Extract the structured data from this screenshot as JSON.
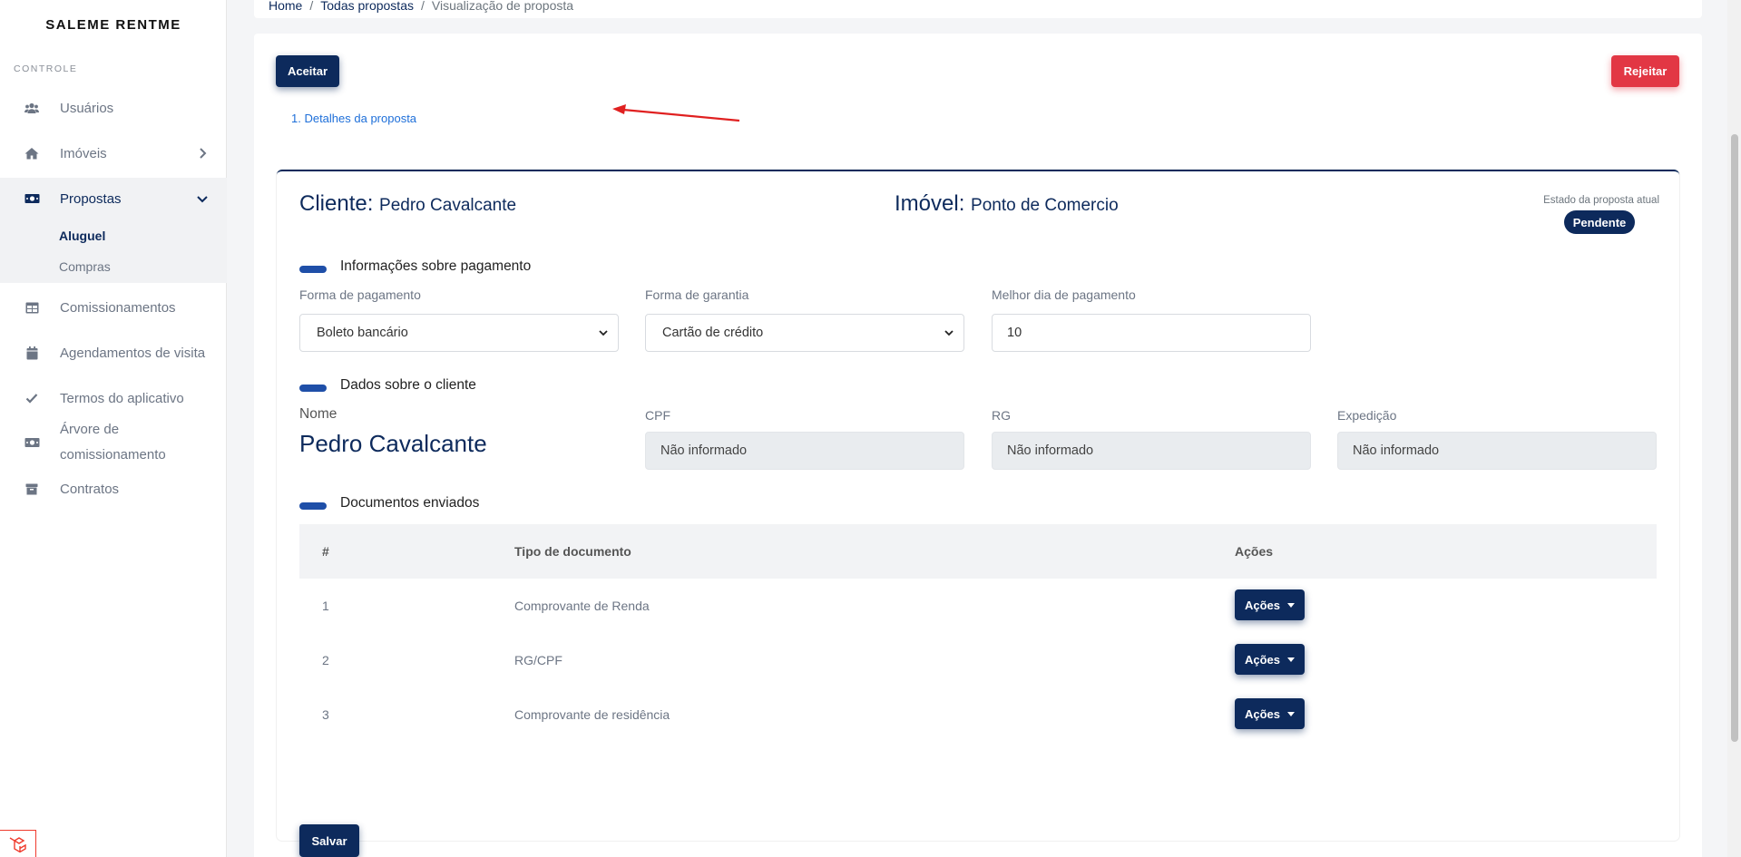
{
  "app": {
    "brand": "SALEME RENTME"
  },
  "sidebar": {
    "section_label": "CONTROLE",
    "items": [
      {
        "label": "Usuários",
        "icon": "users-icon"
      },
      {
        "label": "Imóveis",
        "icon": "home-icon"
      },
      {
        "label": "Propostas",
        "icon": "money-bill-icon"
      },
      {
        "label": "Comissionamentos",
        "icon": "table-icon"
      },
      {
        "label": "Agendamentos de visita",
        "icon": "calendar-icon"
      },
      {
        "label": "Termos do aplicativo",
        "icon": "check-icon"
      },
      {
        "label_line1": "Árvore de",
        "label_line2": "comissionamento",
        "icon": "money-bill-icon"
      },
      {
        "label": "Contratos",
        "icon": "archive-icon"
      }
    ],
    "subitems": [
      {
        "label": "Aluguel"
      },
      {
        "label": "Compras"
      }
    ]
  },
  "breadcrumb": [
    "Home",
    "Todas propostas",
    "Visualização de proposta"
  ],
  "actions": {
    "accept": "Aceitar",
    "reject": "Rejeitar"
  },
  "step": "1. Detalhes da proposta",
  "proposal": {
    "client_label": "Cliente:",
    "client_name": "Pedro Cavalcante",
    "property_label": "Imóvel:",
    "property_name": "Ponto de Comercio",
    "state_label": "Estado da proposta atual",
    "state": "Pendente"
  },
  "payment": {
    "title": "Informações sobre pagamento",
    "method_label": "Forma de pagamento",
    "method_value": "Boleto bancário",
    "guarantee_label": "Forma de garantia",
    "guarantee_value": "Cartão de crédito",
    "best_day_label": "Melhor dia de pagamento",
    "best_day_value": "10"
  },
  "client_data": {
    "title": "Dados sobre o cliente",
    "name_label": "Nome",
    "name_value": "Pedro Cavalcante",
    "cpf_label": "CPF",
    "cpf_value": "Não informado",
    "rg_label": "RG",
    "rg_value": "Não informado",
    "expedition_label": "Expedição",
    "expedition_value": "Não informado"
  },
  "documents": {
    "title": "Documentos enviados",
    "columns": [
      "#",
      "Tipo de documento",
      "Ações"
    ],
    "rows": [
      {
        "num": "1",
        "type": "Comprovante de Renda",
        "action": "Ações"
      },
      {
        "num": "2",
        "type": "RG/CPF",
        "action": "Ações"
      },
      {
        "num": "3",
        "type": "Comprovante de residência",
        "action": "Ações"
      }
    ]
  },
  "save": "Salvar",
  "colors": {
    "navy": "#0d2a5c",
    "red": "#e23744",
    "link": "#1e6fd9",
    "accent_bar": "#1f4fa8"
  }
}
